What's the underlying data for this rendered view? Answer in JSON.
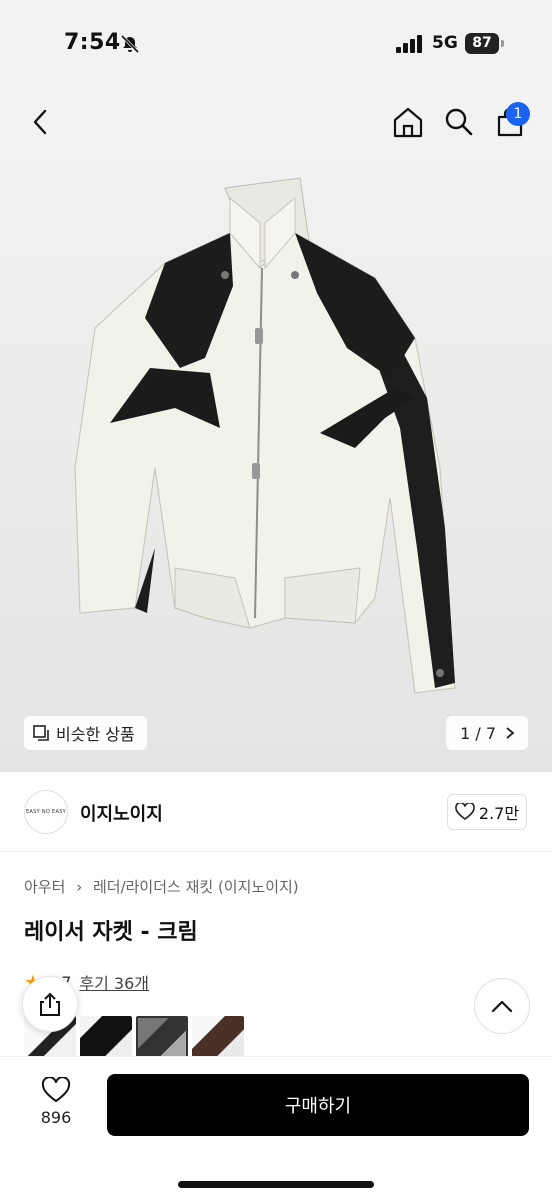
{
  "status": {
    "time": "7:54",
    "network": "5G",
    "battery": "87"
  },
  "nav": {
    "cart_badge": "1"
  },
  "gallery": {
    "similar_label": "비슷한 상품",
    "pager": "1 / 7"
  },
  "brand": {
    "logo_text": "EASY NO EASY",
    "name": "이지노이지",
    "likes": "2.7만"
  },
  "product": {
    "breadcrumb": [
      "아우터",
      "레더/라이더스 재킷 (이지노이지)"
    ],
    "title": "레이서 자켓 - 크림",
    "rating": "4.7",
    "review_link": "후기 36개"
  },
  "bottom": {
    "wish_count": "896",
    "buy_label": "구매하기"
  },
  "colors": {
    "accent_badge": "#1b63f5",
    "buy_button": "#000000",
    "star": "#f6a000"
  },
  "icons": [
    "bell-off-icon",
    "signal-icon",
    "back-icon",
    "home-icon",
    "search-icon",
    "cart-icon",
    "similar-icon",
    "chevron-right-icon",
    "heart-icon",
    "star-icon",
    "share-icon",
    "chevron-up-icon"
  ]
}
